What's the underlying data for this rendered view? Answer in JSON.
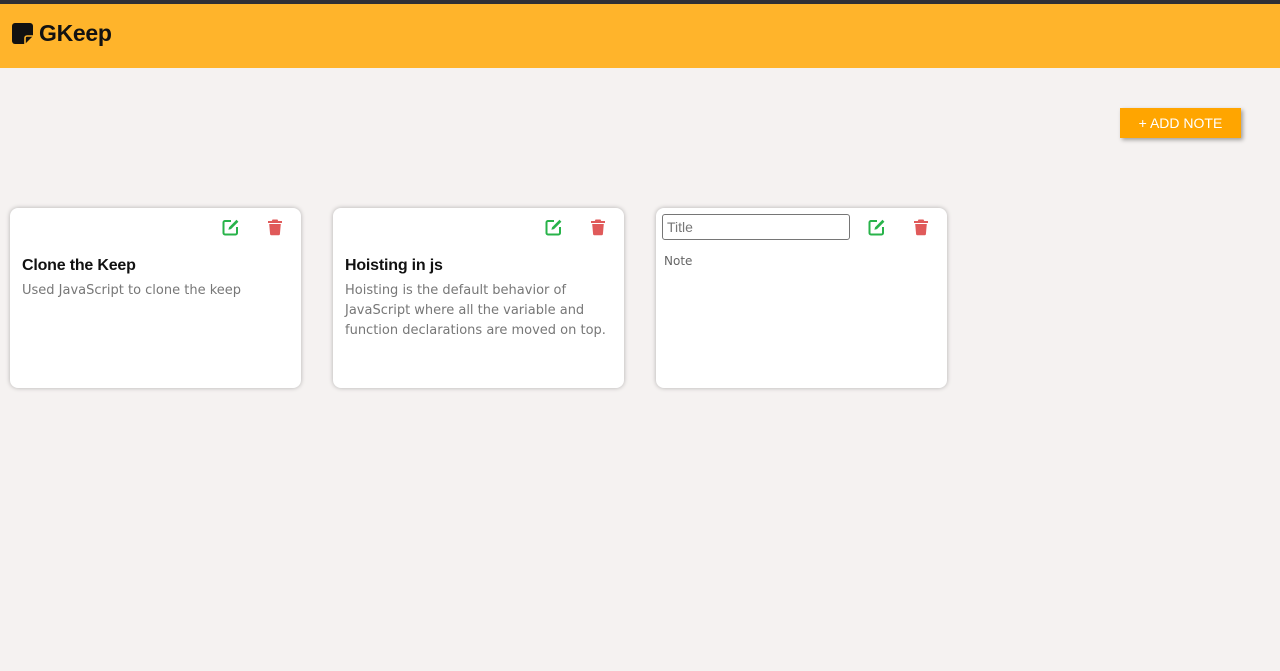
{
  "app": {
    "name": "GKeep"
  },
  "colors": {
    "header": "#ffb42b",
    "button": "#ffa500",
    "edit": "#28b34a",
    "delete": "#e05a5a"
  },
  "toolbar": {
    "add_label": "+ ADD NOTE"
  },
  "notes": [
    {
      "title": "Clone the Keep",
      "body": "Used JavaScript to clone the keep"
    },
    {
      "title": "Hoisting in js",
      "body": "Hoisting is the default behavior of JavaScript where all the variable and function declarations are moved on top."
    }
  ],
  "draft": {
    "title_placeholder": "Title",
    "note_placeholder": "Note"
  }
}
